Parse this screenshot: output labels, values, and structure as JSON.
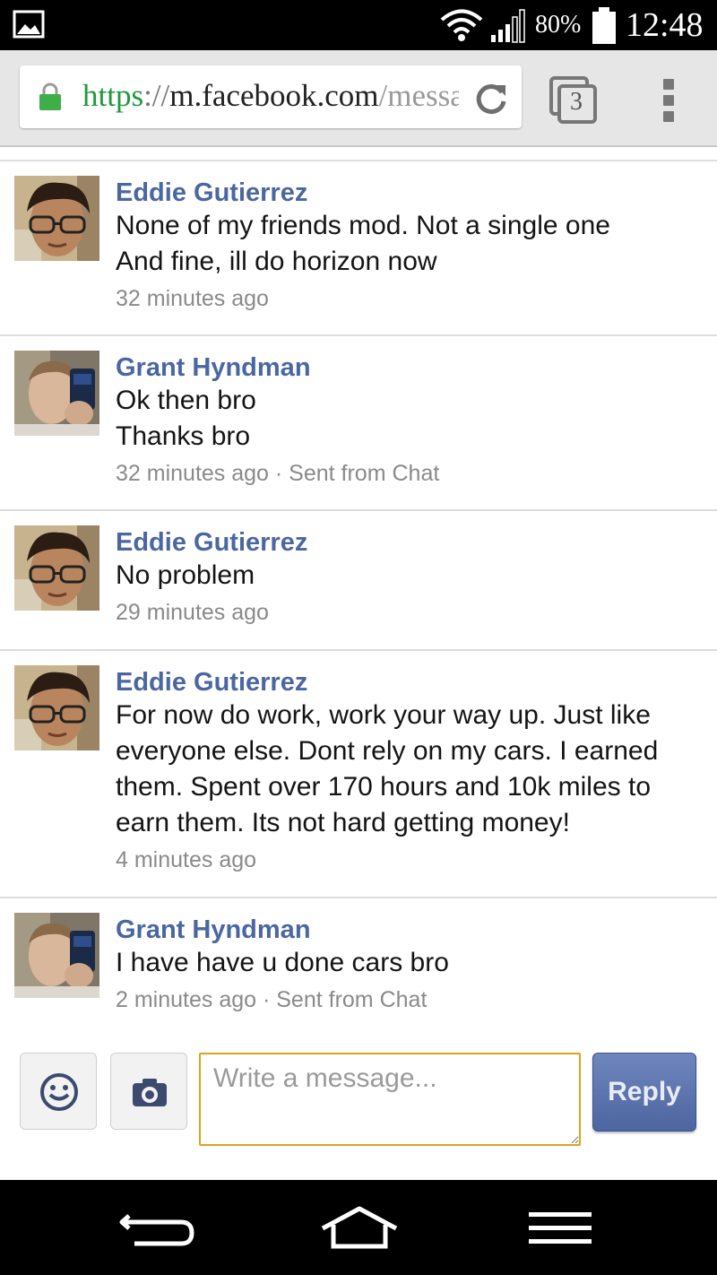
{
  "status_bar": {
    "battery_percent": "80%",
    "time": "12:48",
    "icons": [
      "gallery-icon",
      "wifi-icon",
      "signal-icon",
      "battery-icon"
    ]
  },
  "browser": {
    "url_scheme": "https",
    "url_separator": "://",
    "url_host": "m.facebook.com",
    "url_path": "/messag",
    "tab_count": "3",
    "secure_color": "#3fae49"
  },
  "messages": [
    {
      "sender": "Eddie Gutierrez",
      "lines": [
        "None of my friends mod. Not a single one",
        "And fine, ill do horizon now"
      ],
      "meta": "32 minutes ago"
    },
    {
      "sender": "Grant Hyndman",
      "lines": [
        "Ok then bro",
        "Thanks bro"
      ],
      "meta": "32 minutes ago · Sent from Chat"
    },
    {
      "sender": "Eddie Gutierrez",
      "lines": [
        "No problem"
      ],
      "meta": "29 minutes ago"
    },
    {
      "sender": "Eddie Gutierrez",
      "lines": [
        "For now do work, work your way up. Just like",
        "everyone else. Dont rely on my cars. I earned",
        "them. Spent over 170 hours and 10k miles to",
        "earn them. Its not hard getting money!"
      ],
      "meta": "4 minutes ago"
    },
    {
      "sender": "Grant Hyndman",
      "lines": [
        "I have have u done cars bro"
      ],
      "meta": "2 minutes ago · Sent from Chat"
    }
  ],
  "composer": {
    "placeholder": "Write a message...",
    "reply_label": "Reply",
    "accent_color": "#e0a21c",
    "reply_color": "#4d65a0"
  },
  "colors": {
    "name_link": "#4b67a1",
    "meta_text": "#8a8a8a"
  }
}
